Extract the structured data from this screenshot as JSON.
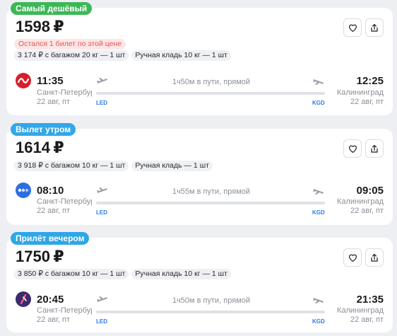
{
  "colors": {
    "badge_cheapest": "#3db756",
    "badge_morning": "#33a7e8",
    "badge_evening": "#2fa6e6",
    "iata": "#2c7be5",
    "warning_text": "#e05656",
    "warning_bg": "#fde6e6"
  },
  "cards": [
    {
      "badge": "Самый дешёвый",
      "price": "1598",
      "currency": "₽",
      "warning": "Остался 1 билет по этой цене",
      "baggage": "3 174 ₽ с багажом 20 кг — 1 шт",
      "hand_luggage": "Ручная кладь 10 кг — 1 шт",
      "airline_icon": "rossiya-airlines-logo",
      "departure": {
        "time": "11:35",
        "city": "Санкт-Петербург",
        "date": "22 авг, пт",
        "iata": "LED"
      },
      "arrival": {
        "time": "12:25",
        "city": "Калининград",
        "date": "22 авг, пт",
        "iata": "KGD"
      },
      "duration": "1ч50м в пути, прямой"
    },
    {
      "badge": "Вылет утром",
      "price": "1614",
      "currency": "₽",
      "baggage": "3 918 ₽ с багажом 10 кг — 1 шт",
      "hand_luggage": "Ручная кладь — 1 шт",
      "airline_icon": "pobeda-airlines-logo",
      "departure": {
        "time": "08:10",
        "city": "Санкт-Петербург",
        "date": "22 авг, пт",
        "iata": "LED"
      },
      "arrival": {
        "time": "09:05",
        "city": "Калининград",
        "date": "22 авг, пт",
        "iata": "KGD"
      },
      "duration": "1ч55м в пути, прямой"
    },
    {
      "badge": "Прилёт вечером",
      "price": "1750",
      "currency": "₽",
      "baggage": "3 850 ₽ с багажом 10 кг — 1 шт",
      "hand_luggage": "Ручная кладь 10 кг — 1 шт",
      "airline_icon": "nordwind-airlines-logo",
      "departure": {
        "time": "20:45",
        "city": "Санкт-Петербург",
        "date": "22 авг, пт",
        "iata": "LED"
      },
      "arrival": {
        "time": "21:35",
        "city": "Калининград",
        "date": "22 авг, пт",
        "iata": "KGD"
      },
      "duration": "1ч50м в пути, прямой"
    }
  ]
}
